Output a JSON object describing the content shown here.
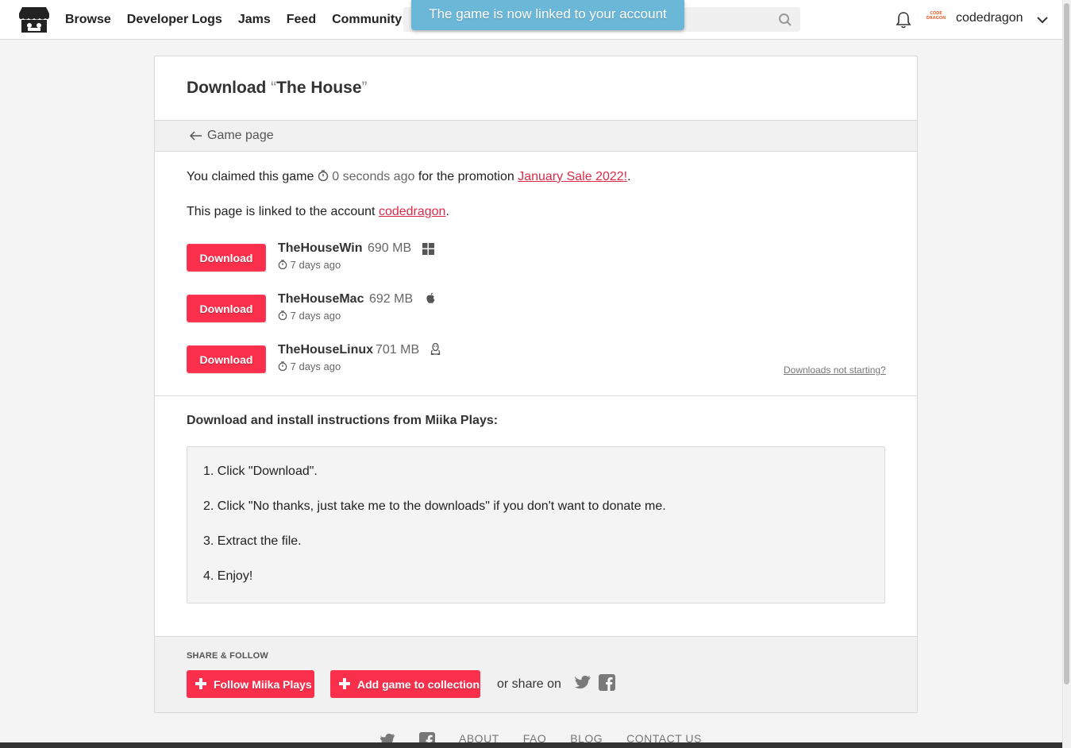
{
  "header": {
    "nav": [
      "Browse",
      "Developer Logs",
      "Jams",
      "Feed",
      "Community"
    ],
    "toast": "The game is now linked to your account",
    "avatar_text": "CODE DRAGON",
    "username": "codedragon"
  },
  "page": {
    "title_prefix": "Download",
    "title_open_quote": "“",
    "game_title": "The House",
    "title_close_quote": "”",
    "back_label": "Game page",
    "claim": {
      "before": "You claimed this game",
      "time": "0 seconds ago",
      "middle": "for the promotion",
      "promotion": "January Sale 2022!",
      "after": "."
    },
    "linked": {
      "before": "This page is linked to the account",
      "account": "codedragon",
      "after": "."
    },
    "download_label": "Download",
    "uploads": [
      {
        "name": "TheHouseWin",
        "size": "690 MB",
        "platform": "windows-icon",
        "date": "7 days ago"
      },
      {
        "name": "TheHouseMac",
        "size": "692 MB",
        "platform": "apple-icon",
        "date": "7 days ago"
      },
      {
        "name": "TheHouseLinux",
        "size": "701 MB",
        "platform": "linux-icon",
        "date": "7 days ago"
      }
    ],
    "not_starting": "Downloads not starting?",
    "instructions_title": "Download and install instructions from Miika Plays:",
    "instructions": [
      "1. Click \"Download\".",
      "2. Click \"No thanks, just take me to the downloads\" if you don't want to donate me.",
      "3. Extract the file.",
      "4. Enjoy!"
    ],
    "share": {
      "label": "SHARE & FOLLOW",
      "follow": "Follow Miika Plays",
      "collection": "Add game to collection",
      "share_on": "or share on"
    }
  },
  "footer": {
    "links": [
      "ABOUT",
      "FAQ",
      "BLOG",
      "CONTACT US"
    ]
  },
  "colors": {
    "accent": "#fa2f4c",
    "link": "#da2c49",
    "toast": "#6bb7d8"
  }
}
